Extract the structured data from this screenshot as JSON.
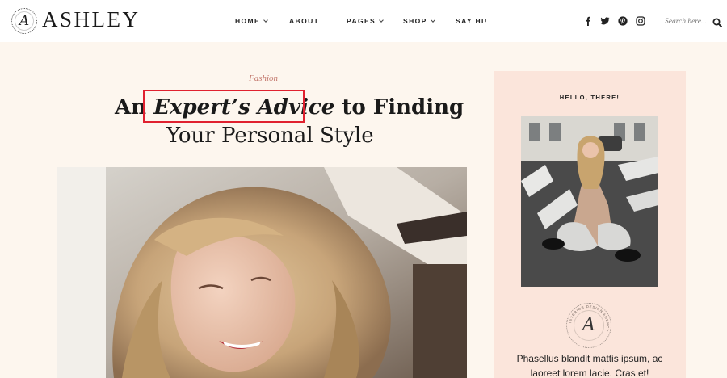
{
  "brand": {
    "logo_letter": "A",
    "name": "ASHLEY"
  },
  "nav": {
    "items": [
      {
        "label": "HOME",
        "has_dropdown": true
      },
      {
        "label": "ABOUT",
        "has_dropdown": false
      },
      {
        "label": "PAGES",
        "has_dropdown": true
      },
      {
        "label": "SHOP",
        "has_dropdown": true
      },
      {
        "label": "SAY HI!",
        "has_dropdown": false
      }
    ]
  },
  "social": [
    "facebook-icon",
    "twitter-icon",
    "pinterest-icon",
    "instagram-icon"
  ],
  "search": {
    "placeholder": "Search here..."
  },
  "article": {
    "category": "Fashion",
    "title_prefix": "An",
    "title_emphasis": "Expert’s Advice",
    "title_suffix": "to Finding",
    "title_line2": "Your Personal Style"
  },
  "sidebar": {
    "heading": "HELLO, THERE!",
    "badge_letter": "A",
    "badge_ring_text": "INTERIOR DESIGN AGENCY",
    "intro_line1": "Phasellus blandit mattis ipsum, ac",
    "intro_line2": "laoreet lorem lacie. Cras et!"
  },
  "colors": {
    "page_background": "#fdf6ee",
    "header_background": "#ffffff",
    "sidebar_background": "#fbe5db",
    "category_color": "#c47a6f",
    "highlight_border": "#e0212f"
  }
}
